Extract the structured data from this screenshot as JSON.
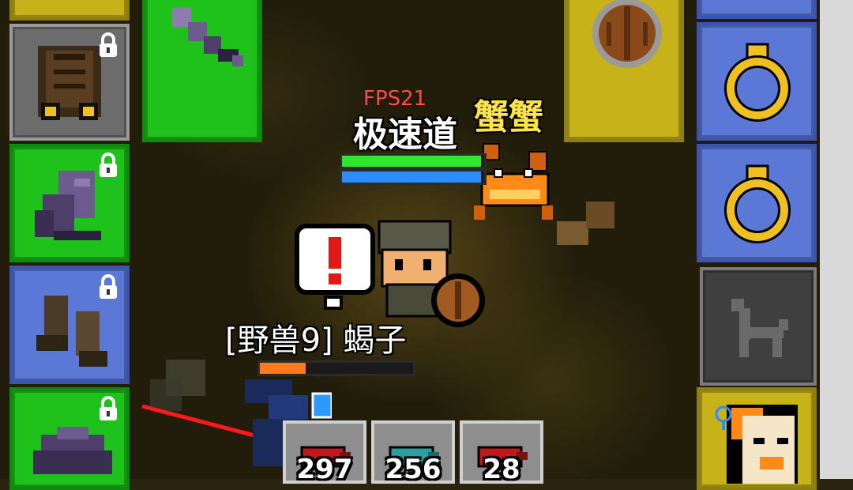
{
  "hud": {
    "fps": "FPS21",
    "player_name": "极速道",
    "crab_name": "蟹蟹",
    "beast_label": "[野兽9] 蝎子"
  },
  "bars": {
    "player_health_fraction": 0.98,
    "player_mana_fraction": 0.98,
    "beast_health_fraction": 0.3
  },
  "left_slots": [
    {
      "icon": "leather-armor-icon",
      "locked": true
    },
    {
      "icon": "purple-glove-icon",
      "locked": true
    },
    {
      "icon": "leather-boots-icon",
      "locked": true
    },
    {
      "icon": "purple-helmet-icon",
      "locked": true
    }
  ],
  "right_slots": [
    {
      "icon": "gold-ring-icon"
    },
    {
      "icon": "gold-ring-icon"
    },
    {
      "icon": "pet-silhouette-icon"
    },
    {
      "icon": "hero-portrait-icon"
    }
  ],
  "quickbar": [
    {
      "icon": "red-potion-icon",
      "count": "297"
    },
    {
      "icon": "blue-potion-icon",
      "count": "256"
    },
    {
      "icon": "red-potion-icon",
      "count": "28"
    }
  ],
  "colors": {
    "slot_green": "#1fc21b",
    "slot_blue": "#5c78d6",
    "slot_yellow": "#c7b21a",
    "health": "#2ee82e",
    "mana": "#2a8cff",
    "beast_health": "#ff7a1a",
    "fps": "#ff4a4a",
    "crab_name": "#ffe34a"
  }
}
